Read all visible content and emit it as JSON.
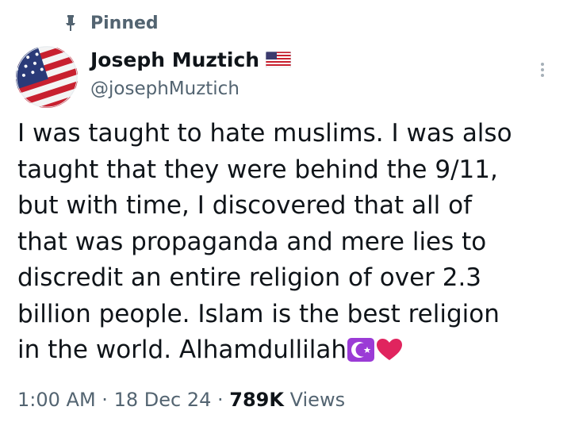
{
  "pinned": {
    "label": "Pinned",
    "icon": "pin-icon"
  },
  "author": {
    "display_name": "Joseph Muztich",
    "handle": "@josephMuztich",
    "flag_emoji": "us-flag-icon",
    "avatar": "american-flag-avatar"
  },
  "tweet": {
    "lines": [
      "I was taught to hate muslims. I was also",
      "taught that they were behind the 9/11,",
      "but with time, I discovered that all of",
      "that was propaganda and mere lies to",
      "discredit an entire religion of over 2.3",
      "billion people. Islam is the best religion",
      "in the world. Alhamdullilah"
    ],
    "trailing_emojis": [
      "star-and-crescent-icon",
      "red-heart-icon"
    ]
  },
  "meta": {
    "time": "1:00 AM",
    "separator": "·",
    "date": "18 Dec 24",
    "views_count": "789K",
    "views_label": "Views"
  },
  "colors": {
    "text_primary": "#0f1419",
    "text_secondary": "#536471",
    "crescent_bg": "#9b3bd6",
    "heart": "#e0245e"
  }
}
